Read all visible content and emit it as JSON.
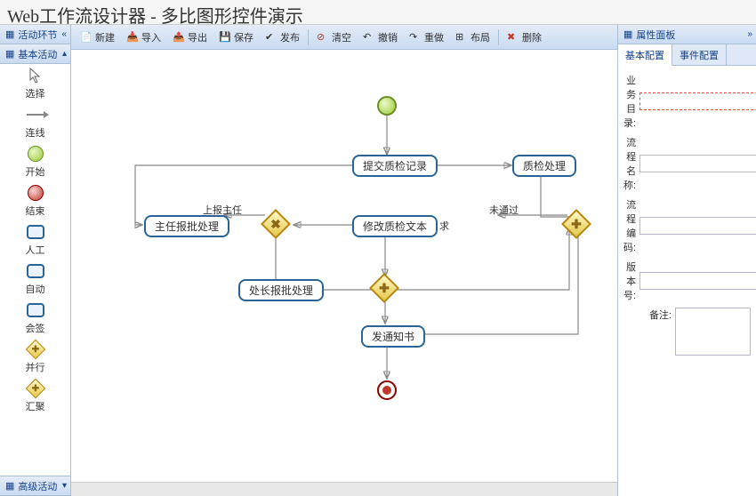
{
  "title": "Web工作流设计器 - 多比图形控件演示",
  "palette": {
    "section_activity": "活动环节",
    "section_basic": "基本活动",
    "section_advanced": "高级活动",
    "items": {
      "select": "选择",
      "connect": "连线",
      "start": "开始",
      "end": "结束",
      "manual": "人工",
      "auto": "自动",
      "countersign": "会签",
      "parallel": "并行",
      "join": "汇聚"
    }
  },
  "toolbar": {
    "new": "新建",
    "import": "导入",
    "export": "导出",
    "save": "保存",
    "publish": "发布",
    "clear": "清空",
    "undo": "撤销",
    "redo": "重做",
    "layout": "布局",
    "delete": "删除"
  },
  "canvas": {
    "nodes": {
      "submit_qc": "提交质检记录",
      "qc_process": "质检处理",
      "modify_qc_text": "修改质检文本",
      "supervisor_approve": "主任报批处理",
      "section_approve": "处长报批处理",
      "send_notice": "发通知书"
    },
    "edges": {
      "report_supervisor": "上报主任",
      "not_passed": "未通过",
      "re": "求"
    }
  },
  "sidepanel": {
    "title": "属性面板",
    "tab_basic": "基本配置",
    "tab_event": "事件配置",
    "form": {
      "biz_dir_lbl": "业务目录:",
      "flow_name_lbl": "流程名称:",
      "flow_code_lbl": "流程编码:",
      "version_lbl": "版本号:",
      "remark_lbl": "备注:"
    }
  }
}
